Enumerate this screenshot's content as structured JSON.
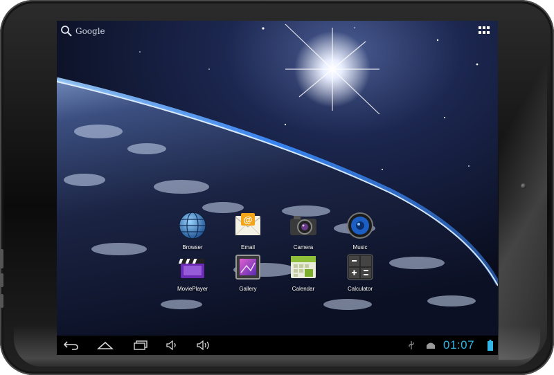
{
  "home": {
    "search_label": "Google",
    "apps": [
      {
        "name": "Browser",
        "icon": "globe-icon"
      },
      {
        "name": "Email",
        "icon": "envelope-icon"
      },
      {
        "name": "Camera",
        "icon": "camera-icon"
      },
      {
        "name": "Music",
        "icon": "speaker-icon"
      },
      {
        "name": "MoviePlayer",
        "icon": "clapperboard-icon"
      },
      {
        "name": "Gallery",
        "icon": "picture-icon"
      },
      {
        "name": "Calendar",
        "icon": "calendar-icon"
      },
      {
        "name": "Calculator",
        "icon": "calculator-icon"
      }
    ]
  },
  "navbar": {
    "buttons": [
      "back-icon",
      "home-icon",
      "recent-apps-icon",
      "volume-down-icon",
      "volume-up-icon"
    ],
    "status_icons": [
      "usb-icon",
      "android-debug-icon",
      "battery-icon"
    ],
    "time": "01:07"
  },
  "colors": {
    "clock": "#33b5e5",
    "atmosphere": "#3a8cff",
    "navbar": "#000000"
  }
}
